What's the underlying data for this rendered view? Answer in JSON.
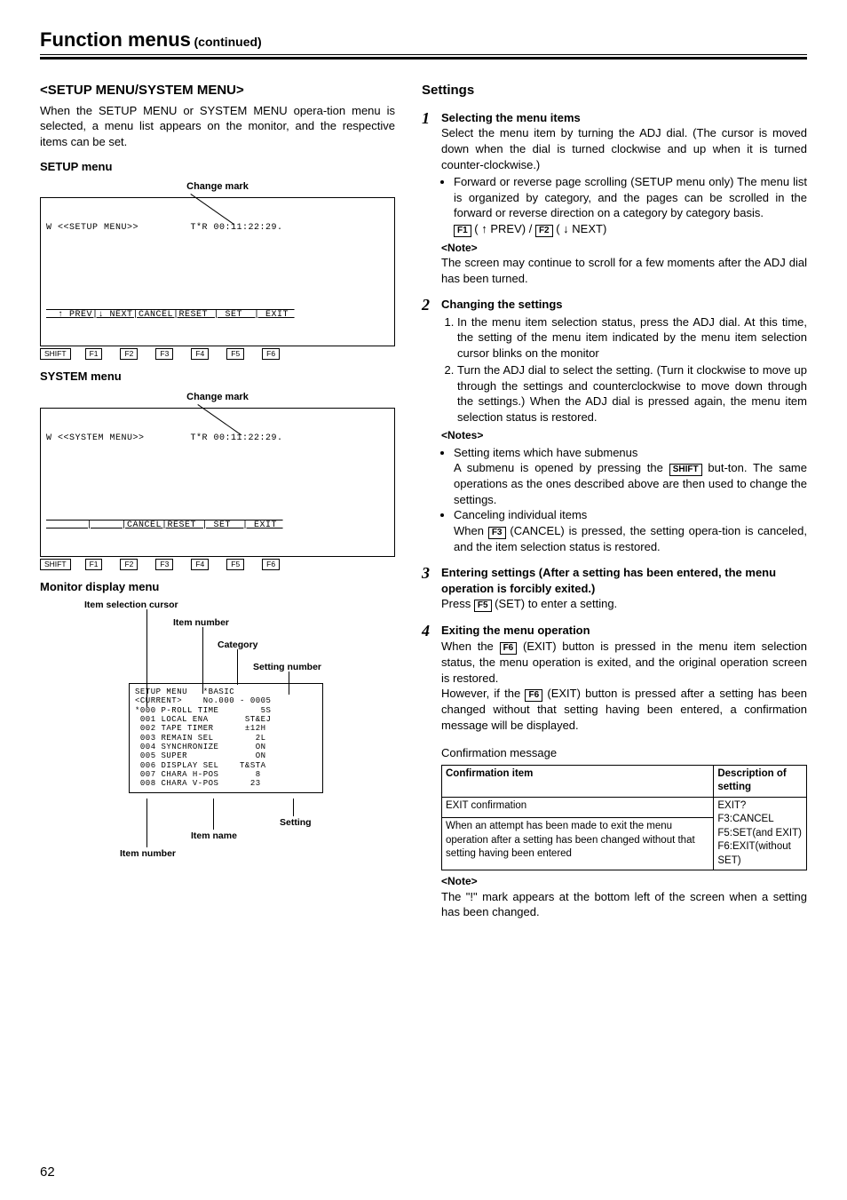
{
  "header": {
    "title": "Function menus",
    "subtitle": "(continued)"
  },
  "left": {
    "subheading": "<SETUP MENU/SYSTEM MENU>",
    "intro": "When the SETUP MENU or SYSTEM MENU opera-tion menu is selected, a menu list appears on the monitor, and the respective items can be set.",
    "setup_label": "SETUP menu",
    "change_mark": "Change mark",
    "setup_osd_line1": "W <<SETUP MENU>>         T*R 00:11:22:29.",
    "setup_osd_bar": "  ↑ PREV|↓ NEXT|CANCEL|RESET | SET  | EXIT ",
    "fkeys": {
      "shift": "SHIFT",
      "f1": "F1",
      "f2": "F2",
      "f3": "F3",
      "f4": "F4",
      "f5": "F5",
      "f6": "F6"
    },
    "system_label": "SYSTEM menu",
    "system_osd_line1": "W <<SYSTEM MENU>>        T*R 00:11:22:29.",
    "system_osd_bar": "       |     |CANCEL|RESET | SET  | EXIT ",
    "monitor_label": "Monitor display menu",
    "labels": {
      "item_sel_cursor": "Item selection cursor",
      "item_number": "Item number",
      "category": "Category",
      "setting_number": "Setting number",
      "setting": "Setting",
      "item_name": "Item name"
    },
    "monitor_osd": "SETUP MENU   *BASIC\n<CURRENT>    No.000 - 0005\n*000 P-ROLL TIME        5S\n 001 LOCAL ENA       ST&EJ\n 002 TAPE TIMER      ±12H\n 003 REMAIN SEL        2L\n 004 SYNCHRONIZE       ON\n 005 SUPER             ON\n 006 DISPLAY SEL    T&STA\n 007 CHARA H-POS       8\n 008 CHARA V-POS      23"
  },
  "right": {
    "heading": "Settings",
    "steps": [
      {
        "num": "1",
        "title": "Selecting the menu items",
        "para1": "Select the menu item by turning the ADJ dial.  (The cursor is moved down when the dial is turned clockwise and up when it is turned counter-clockwise.)",
        "bullet": "Forward or reverse page scrolling (SETUP menu only) The menu list is organized by category, and the pages can be scrolled in the forward or reverse direction on a category by category basis.",
        "keys_line_a": "( ↑ PREV) /",
        "keys_line_b": "( ↓ NEXT)",
        "note_hd": "<Note>",
        "note": "The screen may continue to scroll for a few moments after the ADJ dial has been turned."
      },
      {
        "num": "2",
        "title": "Changing the settings",
        "ol1": "In the menu item selection status, press the ADJ dial. At this time, the setting of the menu item indicated by the menu item selection cursor blinks on the monitor",
        "ol2": "Turn the ADJ dial to select the setting.  (Turn it clockwise to move up through the settings and counterclockwise to move down through the settings.) When the ADJ dial is pressed again, the menu item selection status is restored.",
        "notes_hd": "<Notes>",
        "b1_hd": "Setting items which have submenus",
        "b1_a": "A submenu is opened by pressing the",
        "b1_b": "but-ton.  The same operations as the ones described above are then used to change the settings.",
        "b2_hd": "Canceling individual items",
        "b2_a": "When",
        "b2_b": "(CANCEL) is pressed, the setting opera-tion is canceled, and the item selection status is restored."
      },
      {
        "num": "3",
        "title": "Entering settings (After a setting has been entered, the menu operation is forcibly exited.)",
        "para_a": "Press",
        "para_b": "(SET) to enter a setting."
      },
      {
        "num": "4",
        "title": "Exiting the menu operation",
        "para_a": "When the",
        "para_b": "(EXIT) button is pressed in the menu item selection status, the menu operation is exited, and the original operation screen is restored.",
        "para_c": "However, if the",
        "para_d": "(EXIT) button is pressed after a setting has been changed without that setting having been entered, a confirmation message will be displayed."
      }
    ],
    "conf_label": "Confirmation message",
    "conf_table": {
      "h1": "Confirmation item",
      "h2": "Description of setting",
      "r1c1": "EXIT confirmation",
      "r2c1": "When an attempt has been made to exit the menu operation after a setting has been changed without that setting having been entered",
      "r1c2": "EXIT?\nF3:CANCEL\nF5:SET(and EXIT)\nF6:EXIT(without SET)"
    },
    "final_note_hd": "<Note>",
    "final_note": "The \"!\" mark appears at the bottom left of the screen when a setting has been changed.",
    "keys": {
      "F1": "F1",
      "F2": "F2",
      "F3": "F3",
      "F5": "F5",
      "F6": "F6",
      "SHIFT": "SHIFT"
    }
  },
  "pagenum": "62"
}
